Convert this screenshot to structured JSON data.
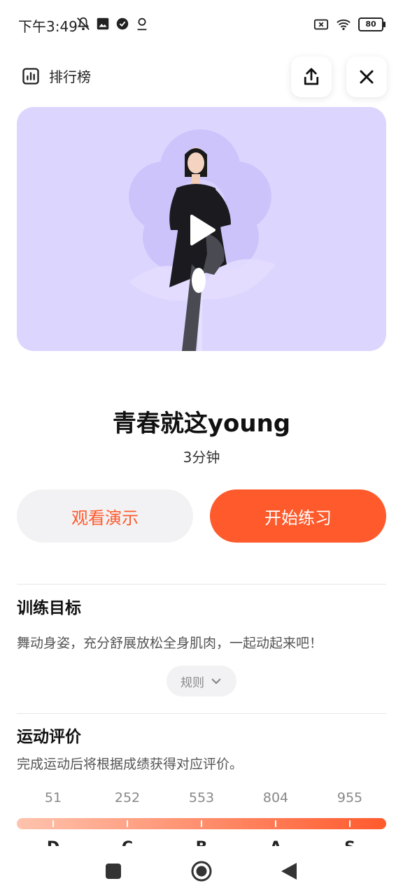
{
  "status_bar": {
    "time": "下午3:49",
    "battery": "80"
  },
  "header": {
    "ranking_label": "排行榜"
  },
  "workout": {
    "title": "青春就这young",
    "duration": "3分钟"
  },
  "actions": {
    "demo_label": "观看演示",
    "start_label": "开始练习"
  },
  "goal": {
    "heading": "训练目标",
    "description": "舞动身姿，充分舒展放松全身肌肉，一起动起来吧！",
    "rules_label": "规则"
  },
  "evaluation": {
    "heading": "运动评价",
    "description": "完成运动后将根据成绩获得对应评价。",
    "scores": [
      "51",
      "252",
      "553",
      "804",
      "955"
    ],
    "grades": [
      "D",
      "C",
      "B",
      "A",
      "S"
    ]
  },
  "colors": {
    "accent": "#ff5a2c",
    "video_bg": "#dcd6ff"
  }
}
